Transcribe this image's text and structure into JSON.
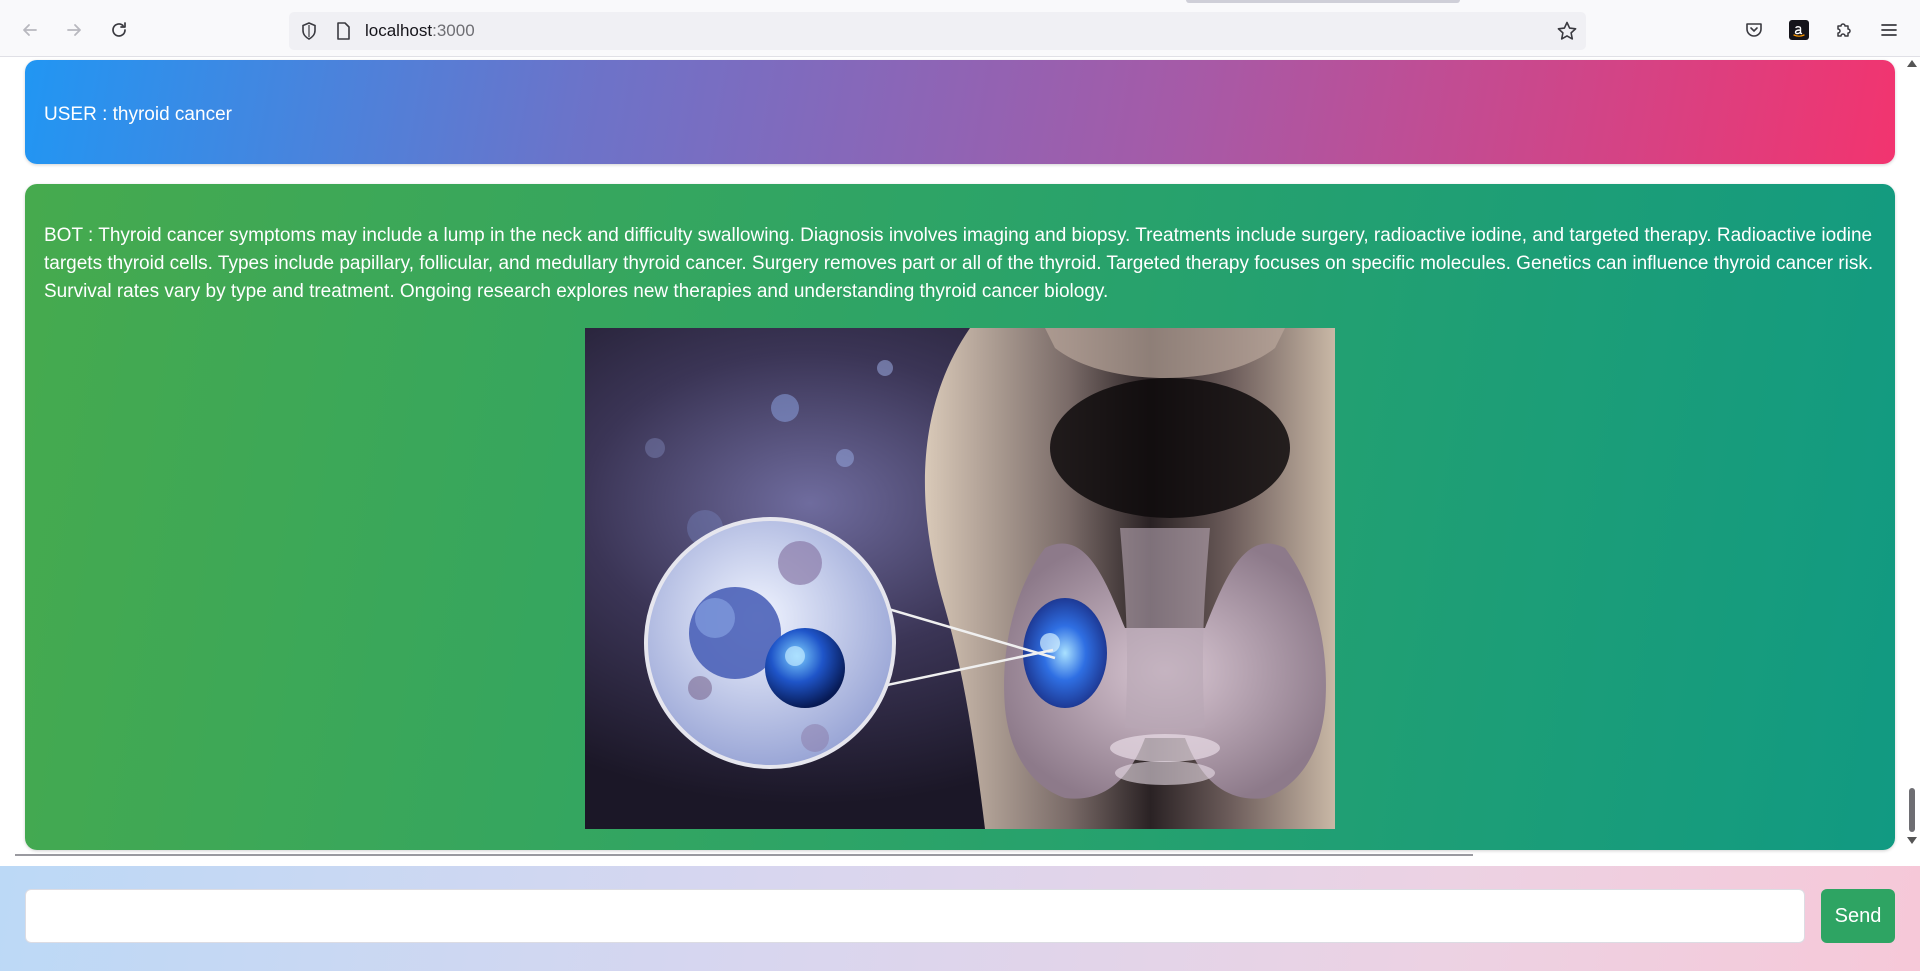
{
  "browser": {
    "url_host": "localhost",
    "url_port": ":3000",
    "icons": [
      "back-icon",
      "forward-icon",
      "reload-icon",
      "shield-icon",
      "page-icon",
      "star-icon",
      "pocket-icon",
      "amazon-icon",
      "extensions-icon",
      "menu-icon"
    ]
  },
  "chat": {
    "messages": [
      {
        "role": "user",
        "text": "USER : thyroid cancer",
        "color_from": "#2196f3",
        "color_to": "#f2346f"
      },
      {
        "role": "bot",
        "text": "BOT : Thyroid cancer symptoms may include a lump in the neck and difficulty swallowing. Diagnosis involves imaging and biopsy. Treatments include surgery, radioactive iodine, and targeted therapy. Radioactive iodine targets thyroid cells. Types include papillary, follicular, and medullary thyroid cancer. Surgery removes part or all of the thyroid. Targeted therapy focuses on specific molecules. Genetics can influence thyroid cancer risk. Survival rates vary by type and treatment. Ongoing research explores new therapies and understanding thyroid cancer biology.",
        "color_from": "#46aa4e",
        "color_to": "#119a82"
      }
    ]
  },
  "composer": {
    "input_value": "",
    "send_label": "Send",
    "send_color": "#2ea463"
  }
}
